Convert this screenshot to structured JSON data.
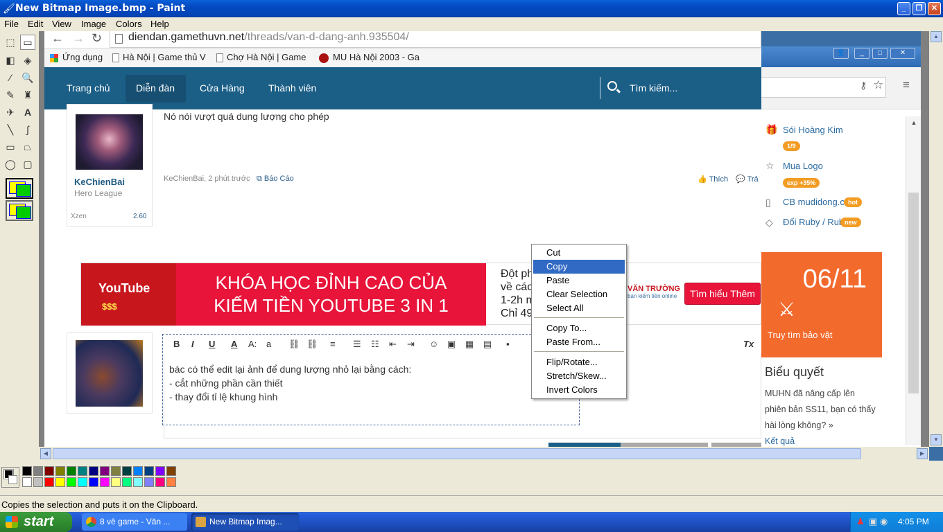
{
  "window": {
    "title": "New Bitmap Image.bmp - Paint"
  },
  "menu": [
    "File",
    "Edit",
    "View",
    "Image",
    "Colors",
    "Help"
  ],
  "browser": {
    "url_host": "diendan.gamethuvn.net",
    "url_path": "/threads/van-d-dang-anh.935504/",
    "bookmarks": [
      "Ứng dụng",
      "Hà Nội | Game thủ V",
      "Chợ Hà Nội | Game",
      "MU Hà Nội 2003 - Ga"
    ],
    "nav": [
      "Trang chủ",
      "Diễn đàn",
      "Cửa Hàng",
      "Thành viên"
    ],
    "search_placeholder": "Tìm kiếm..."
  },
  "post1": {
    "author": "KeChienBai",
    "rank": "Hero League",
    "stat_label": "Xzen",
    "stat_value": "2.60",
    "message": "Nó nói vượt quá dung lượng cho phép",
    "meta": "KeChienBai, 2 phút trước",
    "report": "Báo Cáo",
    "like": "Thích",
    "reply": "Trả"
  },
  "banner": {
    "line1": "KHÓA HỌC ĐỈNH CAO CỦA",
    "line2": "KIẾM TIỀN YOUTUBE 3 IN 1",
    "side_lines": [
      "Đột ph",
      "về các",
      "1-2h m",
      "Chỉ 49"
    ],
    "brand": "VĂN TRƯỜNG",
    "brand_sub": "bạn kiếm tiền online",
    "cta": "Tìm hiểu Thêm",
    "yt_label": "YouTube",
    "money": "$$$"
  },
  "editor": {
    "lines": [
      "bác có thể edit lại ảnh để dung lượng nhỏ lại bằng cách:",
      "- cắt những phần cần thiết",
      "- thay đổi tỉ lệ khung hình"
    ]
  },
  "sidebar": {
    "items": [
      {
        "label": "Sói Hoàng Kim",
        "badge": "1/9"
      },
      {
        "label": "Mua Logo",
        "badge": "exp +35%"
      },
      {
        "label": "CB mudidong.c",
        "badge": "hot"
      },
      {
        "label": "Đổi Ruby / Rub",
        "badge": "new"
      }
    ],
    "date": "06/11",
    "date_caption": "Truy tìm bảo vật",
    "poll_title": "Biểu quyết",
    "poll_text": "MUHN đã nâng cấp lên phiên bản SS11, bạn có thấy hài lòng không? »",
    "poll_link": "Kết quả"
  },
  "context_menu": {
    "items": [
      "Cut",
      "Copy",
      "Paste",
      "Clear Selection",
      "Select All",
      "Copy To...",
      "Paste From...",
      "Flip/Rotate...",
      "Stretch/Skew...",
      "Invert Colors"
    ],
    "highlighted": "Copy"
  },
  "palette": [
    "#000000",
    "#808080",
    "#800000",
    "#808000",
    "#008000",
    "#008080",
    "#000080",
    "#800080",
    "#808040",
    "#004040",
    "#0080ff",
    "#004080",
    "#8000ff",
    "#804000",
    "#ffffff",
    "#c0c0c0",
    "#ff0000",
    "#ffff00",
    "#00ff00",
    "#00ffff",
    "#0000ff",
    "#ff00ff",
    "#ffff80",
    "#00ff80",
    "#80ffff",
    "#8080ff",
    "#ff0080",
    "#ff8040"
  ],
  "status": "Copies the selection and puts it on the Clipboard.",
  "taskbar": {
    "start": "start",
    "tasks": [
      "8 vê game - Văn ...",
      "New Bitmap Imag..."
    ],
    "clock": "4:05 PM"
  }
}
